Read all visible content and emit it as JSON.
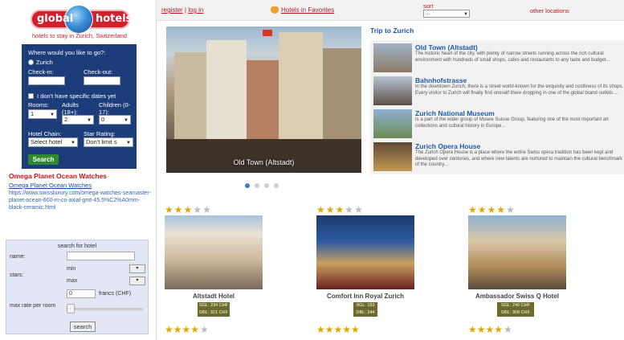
{
  "logo": {
    "word1": "global",
    "word2": "hotels",
    "tagline": "hotels to stay in Zurich, Switzerland"
  },
  "search": {
    "question": "Where would you like to go?:",
    "destination": "Zurich",
    "checkin_label": "Check-in:",
    "checkout_label": "Check-out:",
    "nodates_label": "I don't have specific dates yet",
    "rooms_label": "Rooms:",
    "rooms_value": "1",
    "adults_label": "Adults (18+):",
    "adults_value": "2",
    "children_label": "Children (0-17):",
    "children_value": "0",
    "chain_label": "Hotel Chain:",
    "chain_value": "Select hotel",
    "rating_label": "Star Rating:",
    "rating_value": "Don't limit s",
    "button": "Search"
  },
  "ad": {
    "title": "Omega Planet Ocean Watches",
    "link": "Omega Planet Ocean Watches",
    "url": "https://www.swissluxury.com/omega-watches-seamaster-planet-ocean-600-m-co-axial-gmt-45.5%C2%A0mm-black-ceramic.html"
  },
  "filter": {
    "heading": "search for hotel",
    "name_label": "name:",
    "stars_label": "stars:",
    "min_label": "min",
    "max_label": "max",
    "dd_arrow": "▾",
    "rate_label": "max rate per room",
    "rate_value": "0",
    "currency": "francs (CHF)",
    "button": "search"
  },
  "topbar": {
    "register": "register",
    "separator": "|",
    "login": "log in",
    "favorites": "Hotels in Favorites",
    "sort_label": "sort",
    "sort_value": "...",
    "other": "other locations"
  },
  "hero": {
    "caption": "Old Town (Altstadt)",
    "slide_count": 4,
    "active_slide": 1
  },
  "trip": {
    "title": "Trip to Zurich",
    "items": [
      {
        "name": "Old Town (Altstadt)",
        "desc": "The historic heart of the city, with plenty of narrow streets running across the rich cultural environment with hundreds of small shops, cafes and restaurants to any taste and budget..."
      },
      {
        "name": "Bahnhofstrasse",
        "desc": "In the downtown Zurich, there is a street world-known for the exquisity and costliness of its shops. Every visitor to Zurich will finally find oneself there dropping in one of the global brand outlets ..."
      },
      {
        "name": "Zurich National Museum",
        "desc": "Is a part of the wider group of Musee Suisse Group, featuring one of the most important art collections and cultural history in Europe..."
      },
      {
        "name": "Zurich Opera House",
        "desc": "The Zurich Opera House is a place where the entire Swiss opera tradition has been kept and developed over centuries, and where new talents are nurtured to maintain the cultural benchmark of the country..."
      }
    ]
  },
  "hotels": [
    {
      "name": "Altstadt Hotel",
      "stars": 3,
      "sgl": "SGL: 234 CHF",
      "dbl": "DBL: 321 CHF"
    },
    {
      "name": "Comfort Inn Royal Zurich",
      "stars": 3,
      "sgl": "SGL: 153",
      "dbl": "DBL: 244"
    },
    {
      "name": "Ambassador Swiss Q Hotel",
      "stars": 4,
      "sgl": "SGL: 240 CHF",
      "dbl": "DBL: 309 CHF"
    }
  ],
  "second_row_stars": [
    4,
    5,
    4
  ],
  "colors": {
    "brand_red": "#c0181f",
    "navy": "#1c3d79",
    "link_blue": "#1c5aa8",
    "star": "#e0a800"
  }
}
